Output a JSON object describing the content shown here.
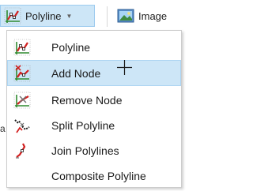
{
  "ribbon": {
    "polyline_button": {
      "label": "Polyline",
      "icon": "polyline-icon",
      "dropdown": true
    },
    "image_button": {
      "label": "Image",
      "icon": "image-icon"
    }
  },
  "left_edge": {
    "partial_char": "a"
  },
  "menu": {
    "hovered_index": 1,
    "items": [
      {
        "label": "Polyline",
        "icon": "polyline-icon"
      },
      {
        "label": "Add Node",
        "icon": "add-node-icon"
      },
      {
        "label": "Remove Node",
        "icon": "remove-node-icon"
      },
      {
        "label": "Split Polyline",
        "icon": "split-polyline-icon"
      },
      {
        "label": "Join Polylines",
        "icon": "join-polylines-icon"
      },
      {
        "label": "Composite Polyline",
        "icon": ""
      }
    ]
  },
  "colors": {
    "hover_bg": "#cde6f7",
    "hover_border": "#aed5f2",
    "icon_red": "#d22020",
    "icon_green": "#3c8a2e",
    "icon_grey": "#707070"
  }
}
